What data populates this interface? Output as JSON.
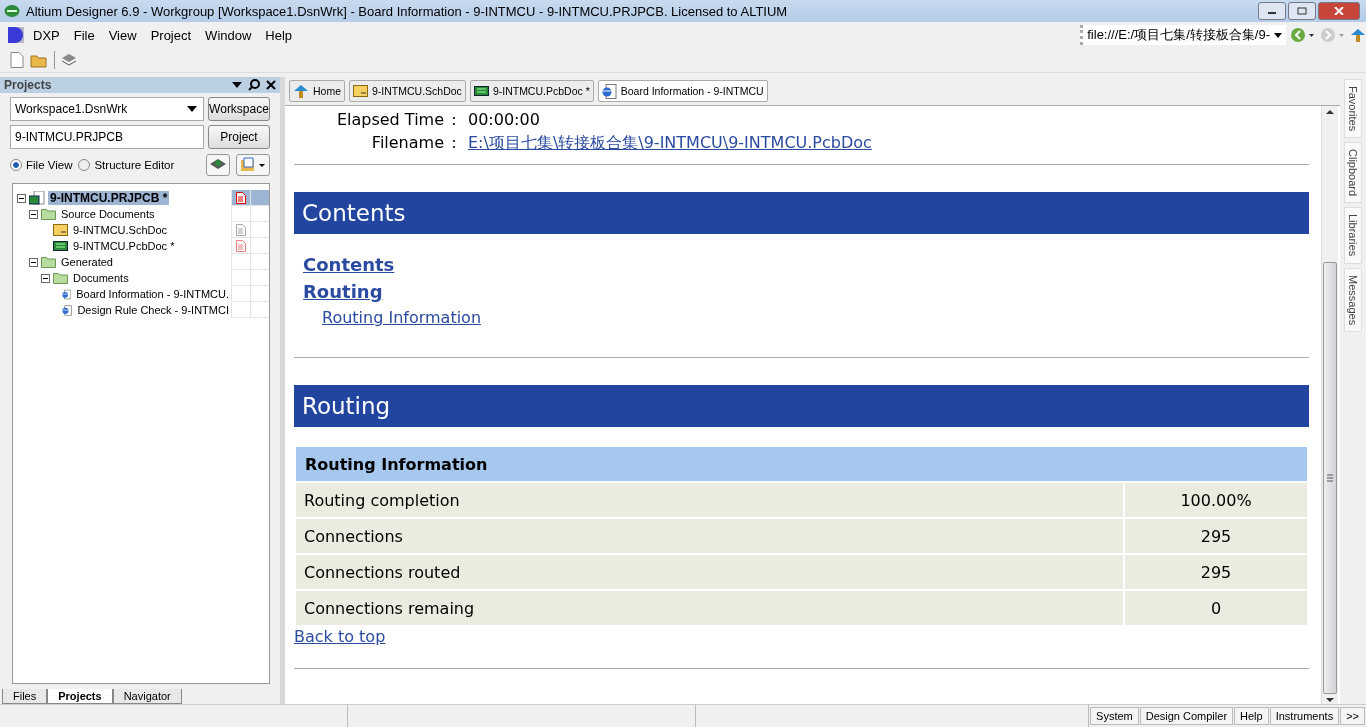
{
  "window": {
    "title": "Altium Designer 6.9 - Workgroup [Workspace1.DsnWrk] - Board Information - 9-INTMCU - 9-INTMCU.PRJPCB. Licensed to ALTIUM"
  },
  "menu": [
    "DXP",
    "File",
    "View",
    "Project",
    "Window",
    "Help"
  ],
  "address_bar": {
    "value": "file:///E:/项目七集/转接板合集/9-"
  },
  "projects_panel": {
    "title": "Projects",
    "workspace": {
      "value": "Workspace1.DsnWrk",
      "button": "Workspace"
    },
    "project": {
      "value": "9-INTMCU.PRJPCB",
      "button": "Project"
    },
    "views": [
      {
        "label": "File View",
        "selected": true
      },
      {
        "label": "Structure Editor",
        "selected": false
      }
    ],
    "tree": [
      {
        "label": "9-INTMCU.PRJPCB *",
        "kind": "project",
        "selected": true,
        "expanded": true,
        "color": "#e00000",
        "children": [
          {
            "label": "Source Documents",
            "kind": "folder",
            "selected": false,
            "expanded": true,
            "children": [
              {
                "label": "9-INTMCU.SchDoc",
                "kind": "schdoc",
                "selected": false,
                "color": "#a8a8a8"
              },
              {
                "label": "9-INTMCU.PcbDoc *",
                "kind": "pcbdoc",
                "selected": false,
                "color": "#f08080"
              }
            ]
          },
          {
            "label": "Generated",
            "kind": "folder",
            "selected": false,
            "expanded": true,
            "children": [
              {
                "label": "Documents",
                "kind": "folder",
                "selected": false,
                "expanded": true,
                "children": [
                  {
                    "label": "Board Information - 9-INTMCU.",
                    "kind": "html",
                    "selected": false
                  },
                  {
                    "label": "Design Rule Check - 9-INTMCI",
                    "kind": "html",
                    "selected": false
                  }
                ]
              }
            ]
          }
        ]
      }
    ],
    "bottom_tabs": [
      {
        "label": "Files",
        "selected": false
      },
      {
        "label": "Projects",
        "selected": true
      },
      {
        "label": "Navigator",
        "selected": false
      }
    ]
  },
  "doc_tabs": [
    {
      "label": "Home",
      "kind": "home",
      "selected": false
    },
    {
      "label": "9-INTMCU.SchDoc",
      "kind": "schdoc",
      "selected": false
    },
    {
      "label": "9-INTMCU.PcbDoc *",
      "kind": "pcbdoc",
      "selected": false
    },
    {
      "label": "Board Information - 9-INTMCU",
      "kind": "html",
      "selected": true
    }
  ],
  "report": {
    "info": [
      {
        "label": "Elapsed Time",
        "sep": ":",
        "value": "00:00:00",
        "kind": "text"
      },
      {
        "label": "Filename",
        "sep": ":",
        "value": "E:\\项目七集\\转接板合集\\9-INTMCU\\9-INTMCU.PcbDoc",
        "kind": "link"
      }
    ],
    "contents": {
      "heading": "Contents",
      "links": [
        {
          "label": "Contents"
        },
        {
          "label": "Routing",
          "children": [
            {
              "label": "Routing Information"
            }
          ]
        }
      ]
    },
    "routing": {
      "heading": "Routing",
      "table_title": "Routing Information",
      "rows": [
        {
          "label": "Routing completion",
          "value": "100.00%"
        },
        {
          "label": "Connections",
          "value": "295"
        },
        {
          "label": "Connections routed",
          "value": "295"
        },
        {
          "label": "Connections remaing",
          "value": "0"
        }
      ],
      "back_link": "Back to top"
    }
  },
  "side_tabs": [
    "Favorites",
    "Clipboard",
    "Libraries",
    "Messages"
  ],
  "status_bar": [
    "System",
    "Design Compiler",
    "Help",
    "Instruments",
    ">>"
  ]
}
